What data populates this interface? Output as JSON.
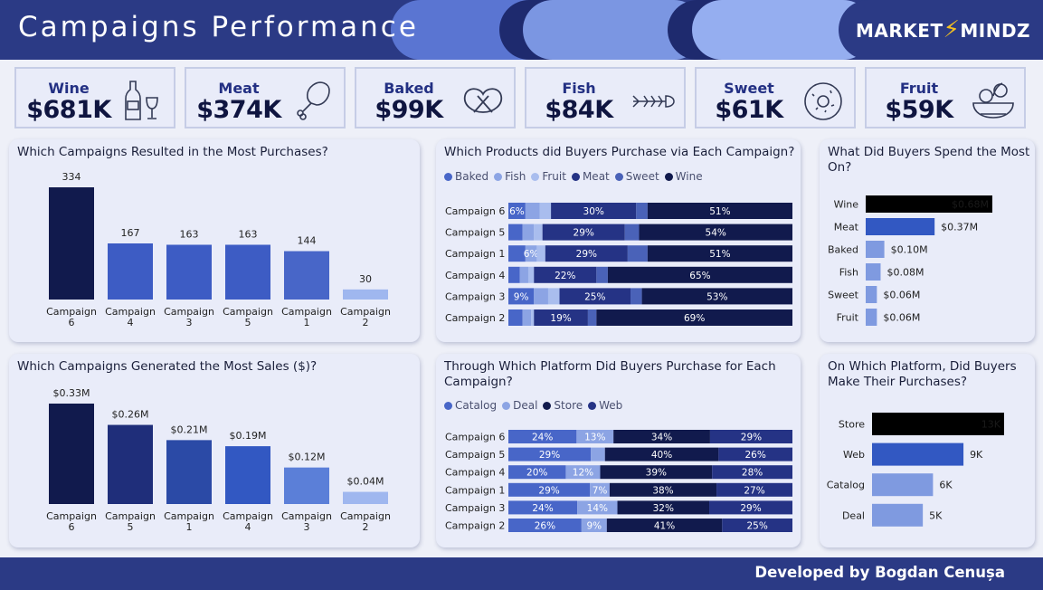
{
  "header": {
    "title": "Campaigns Performance"
  },
  "logo": {
    "left": "MARKET",
    "bolt": "⚡",
    "right": "MINDZ"
  },
  "kpis": [
    {
      "label": "Wine",
      "value": "$681K",
      "icon": "wine-bottle-icon"
    },
    {
      "label": "Meat",
      "value": "$374K",
      "icon": "meat-leg-icon"
    },
    {
      "label": "Baked",
      "value": "$99K",
      "icon": "pretzel-icon"
    },
    {
      "label": "Fish",
      "value": "$84K",
      "icon": "fish-bone-icon"
    },
    {
      "label": "Sweet",
      "value": "$61K",
      "icon": "donut-icon"
    },
    {
      "label": "Fruit",
      "value": "$59K",
      "icon": "fruit-bowl-icon"
    }
  ],
  "panels": {
    "purchases": {
      "title": "Which Campaigns Resulted in the Most Purchases?"
    },
    "sales": {
      "title": "Which Campaigns Generated the Most Sales ($)?"
    },
    "products": {
      "title": "Which Products did Buyers Purchase via Each Campaign?"
    },
    "platforms": {
      "title": "Through Which Platform Did Buyers Purchase for Each Campaign?"
    },
    "spend": {
      "title": "What Did Buyers Spend the Most On?"
    },
    "platform_total": {
      "title": "On Which Platform, Did Buyers Make Their Purchases?"
    }
  },
  "footer": {
    "text": "Developed by Bogdan Cenușa"
  },
  "colors": {
    "navy": "#111a4d",
    "dark_blue": "#1f2e7a",
    "royal": "#2f4fb5",
    "mid": "#4866c8",
    "medium": "#5876d0",
    "light": "#8ca4e4",
    "pale": "#9fb7ef"
  },
  "chart_data": [
    {
      "id": "purchases",
      "type": "bar",
      "categories": [
        "Campaign 6",
        "Campaign 4",
        "Campaign 3",
        "Campaign 5",
        "Campaign 1",
        "Campaign 2"
      ],
      "values": [
        334,
        167,
        163,
        163,
        144,
        30
      ],
      "labels": [
        "334",
        "167",
        "163",
        "163",
        "144",
        "30"
      ],
      "colors": [
        "#111a4d",
        "#3d5cc4",
        "#3d5cc4",
        "#3d5cc4",
        "#4866c8",
        "#9fb7ef"
      ]
    },
    {
      "id": "sales",
      "type": "bar",
      "categories": [
        "Campaign 6",
        "Campaign 5",
        "Campaign 1",
        "Campaign 4",
        "Campaign 3",
        "Campaign 2"
      ],
      "values": [
        0.33,
        0.26,
        0.21,
        0.19,
        0.12,
        0.04
      ],
      "labels": [
        "$0.33M",
        "$0.26M",
        "$0.21M",
        "$0.19M",
        "$0.12M",
        "$0.04M"
      ],
      "colors": [
        "#111a4d",
        "#1f2e7a",
        "#2b4aa6",
        "#3258c2",
        "#5b7fd8",
        "#9fb7ef"
      ]
    },
    {
      "id": "products",
      "type": "bar",
      "stacked": true,
      "orientation": "horizontal",
      "categories": [
        "Campaign 6",
        "Campaign 5",
        "Campaign 1",
        "Campaign 4",
        "Campaign 3",
        "Campaign 2"
      ],
      "series": [
        {
          "name": "Baked",
          "color": "#4866c8",
          "values": [
            6,
            5,
            6,
            4,
            9,
            5
          ]
        },
        {
          "name": "Fish",
          "color": "#8ca4e4",
          "values": [
            5,
            4,
            4,
            3,
            5,
            3
          ]
        },
        {
          "name": "Fruit",
          "color": "#a9bdee",
          "values": [
            4,
            3,
            3,
            2,
            4,
            1
          ]
        },
        {
          "name": "Meat",
          "color": "#253385",
          "values": [
            30,
            29,
            29,
            22,
            25,
            19
          ]
        },
        {
          "name": "Sweet",
          "color": "#4a62b8",
          "values": [
            4,
            5,
            7,
            4,
            4,
            3
          ]
        },
        {
          "name": "Wine",
          "color": "#111a4d",
          "values": [
            51,
            54,
            51,
            65,
            53,
            69
          ]
        }
      ],
      "value_labels_shown": {
        "Baked": [
          "6%",
          "",
          "",
          "",
          "9%",
          ""
        ],
        "Fish": [
          "",
          "",
          "6%",
          "",
          "",
          ""
        ]
      }
    },
    {
      "id": "platforms",
      "type": "bar",
      "stacked": true,
      "orientation": "horizontal",
      "categories": [
        "Campaign 6",
        "Campaign 5",
        "Campaign 4",
        "Campaign 1",
        "Campaign 3",
        "Campaign 2"
      ],
      "series": [
        {
          "name": "Catalog",
          "color": "#4866c8",
          "values": [
            24,
            29,
            20,
            29,
            24,
            26
          ]
        },
        {
          "name": "Deal",
          "color": "#8ca4e4",
          "values": [
            13,
            5,
            12,
            7,
            14,
            9
          ]
        },
        {
          "name": "Store",
          "color": "#111a4d",
          "values": [
            34,
            40,
            39,
            38,
            32,
            41
          ]
        },
        {
          "name": "Web",
          "color": "#253385",
          "values": [
            29,
            26,
            28,
            27,
            29,
            25
          ]
        }
      ],
      "value_labels_shown": {
        "Deal": [
          "13%",
          "",
          "12%",
          "7%",
          "14%",
          "9%"
        ]
      }
    },
    {
      "id": "spend",
      "type": "bar",
      "orientation": "horizontal",
      "categories": [
        "Wine",
        "Meat",
        "Baked",
        "Fish",
        "Sweet",
        "Fruit"
      ],
      "values": [
        0.68,
        0.37,
        0.1,
        0.08,
        0.06,
        0.06
      ],
      "labels": [
        "$0.68M",
        "$0.37M",
        "$0.10M",
        "$0.08M",
        "$0.06M",
        "$0.06M"
      ],
      "colors": [
        "#000000",
        "#3258c2",
        "#7f9ae0",
        "#7f9ae0",
        "#7f9ae0",
        "#7f9ae0"
      ]
    },
    {
      "id": "platform_total",
      "type": "bar",
      "orientation": "horizontal",
      "categories": [
        "Store",
        "Web",
        "Catalog",
        "Deal"
      ],
      "values": [
        13,
        9,
        6,
        5
      ],
      "labels": [
        "13K",
        "9K",
        "6K",
        "5K"
      ],
      "colors": [
        "#000000",
        "#3258c2",
        "#7f9ae0",
        "#7f9ae0"
      ]
    }
  ]
}
